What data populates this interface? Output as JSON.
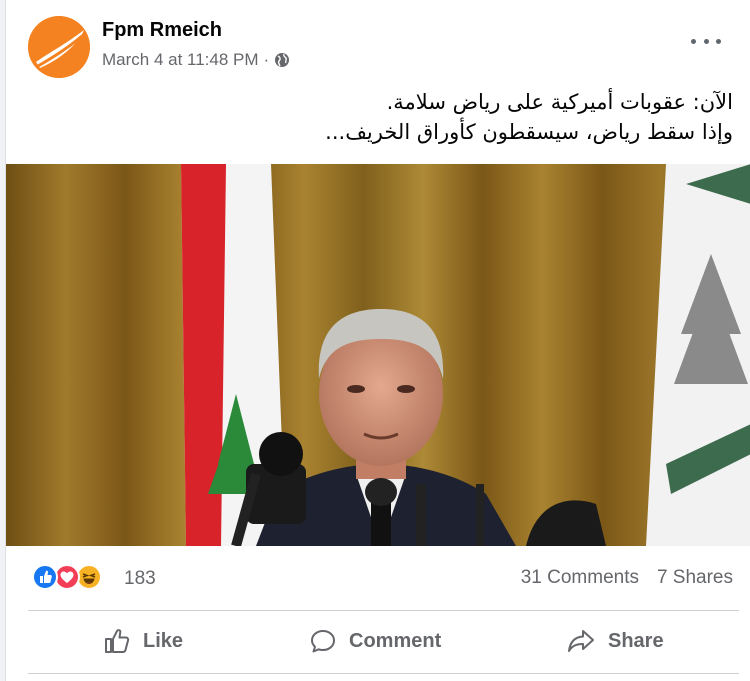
{
  "post": {
    "author": "Fpm Rmeich",
    "timestamp": "March 4 at 11:48 PM",
    "separator": "·",
    "audience_icon": "globe-icon",
    "text_line1": "الآن: عقوبات أميركية على رياض سلامة.",
    "text_line2": "وإذا سقط رياض، سيسقطون كأوراق الخريف..."
  },
  "stats": {
    "reaction_count": "183",
    "reaction_icons": [
      "like-reaction-icon",
      "love-reaction-icon",
      "haha-reaction-icon"
    ],
    "comments": "31 Comments",
    "shares": "7 Shares"
  },
  "actions": {
    "like_label": "Like",
    "comment_label": "Comment",
    "share_label": "Share"
  },
  "colors": {
    "like_blue": "#1877f2",
    "love_red": "#f33e58",
    "haha_yellow": "#f7b125",
    "secondary_text": "#65676b",
    "avatar_orange": "#f58220"
  }
}
